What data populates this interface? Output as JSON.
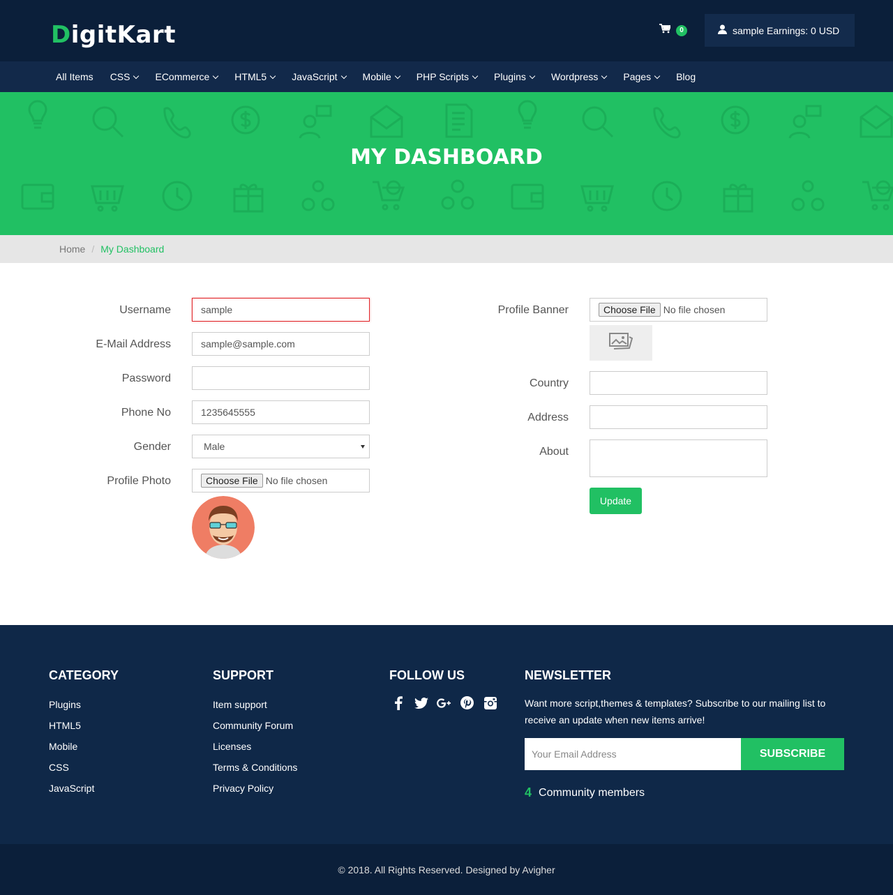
{
  "brand": {
    "logo_first": "D",
    "logo_rest": "igitKart"
  },
  "header": {
    "cart_count": "0",
    "user_text": "sample Earnings: 0 USD"
  },
  "nav": [
    {
      "label": "All Items"
    },
    {
      "label": "CSS"
    },
    {
      "label": "ECommerce"
    },
    {
      "label": "HTML5"
    },
    {
      "label": "JavaScript"
    },
    {
      "label": "Mobile"
    },
    {
      "label": "PHP Scripts"
    },
    {
      "label": "Plugins"
    },
    {
      "label": "Wordpress"
    },
    {
      "label": "Pages"
    },
    {
      "label": "Blog"
    }
  ],
  "hero": {
    "title": "MY DASHBOARD"
  },
  "breadcrumb": {
    "home": "Home",
    "separator": "/",
    "current": "My Dashboard"
  },
  "form": {
    "username_label": "Username",
    "username_value": "sample",
    "email_label": "E-Mail Address",
    "email_value": "sample@sample.com",
    "password_label": "Password",
    "password_value": "",
    "phone_label": "Phone No",
    "phone_value": "1235645555",
    "gender_label": "Gender",
    "gender_value": "Male",
    "photo_label": "Profile Photo",
    "file_button": "Choose File",
    "file_status": "No file chosen",
    "banner_label": "Profile Banner",
    "country_label": "Country",
    "address_label": "Address",
    "about_label": "About",
    "update_button": "Update"
  },
  "footer": {
    "category_title": "CATEGORY",
    "category_links": [
      "Plugins",
      "HTML5",
      "Mobile",
      "CSS",
      "JavaScript"
    ],
    "support_title": "SUPPORT",
    "support_links": [
      "Item support",
      "Community Forum",
      "Licenses",
      "Terms & Conditions",
      "Privacy Policy"
    ],
    "follow_title": "FOLLOW US",
    "social_icons": [
      "facebook-icon",
      "twitter-icon",
      "google-plus-icon",
      "pinterest-icon",
      "instagram-icon"
    ],
    "newsletter_title": "NEWSLETTER",
    "newsletter_text": "Want more script,themes & templates? Subscribe to our mailing list to receive an update when new items arrive!",
    "email_placeholder": "Your Email Address",
    "subscribe_button": "SUBSCRIBE",
    "members_count": "4",
    "members_label": "Community members"
  },
  "copyright": "© 2018. All Rights Reserved. Designed by Avigher",
  "colors": {
    "accent": "#21c063",
    "navy": "#0b1f3a",
    "footer": "#0f2848",
    "error": "#e1262a"
  }
}
